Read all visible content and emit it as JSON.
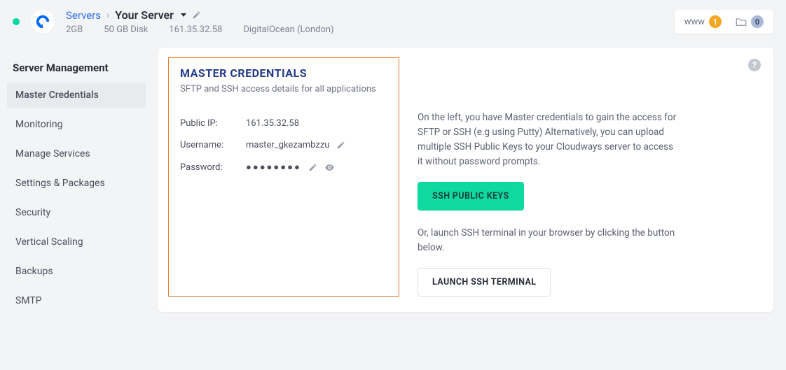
{
  "header": {
    "breadcrumb_root": "Servers",
    "breadcrumb_current": "Your Server",
    "specs": {
      "ram": "2GB",
      "disk": "50 GB Disk",
      "ip": "161.35.32.58",
      "provider_region": "DigitalOcean (London)"
    },
    "right": {
      "www_label": "www",
      "www_count": "1",
      "projects_count": "0"
    }
  },
  "sidebar": {
    "title": "Server Management",
    "items": [
      "Master Credentials",
      "Monitoring",
      "Manage Services",
      "Settings & Packages",
      "Security",
      "Vertical Scaling",
      "Backups",
      "SMTP"
    ]
  },
  "credentials": {
    "title": "MASTER CREDENTIALS",
    "subtitle": "SFTP and SSH access details for all applications",
    "rows": {
      "public_ip_label": "Public IP:",
      "public_ip_value": "161.35.32.58",
      "username_label": "Username:",
      "username_value": "master_gkezambzzu",
      "password_label": "Password:",
      "password_masked": "●●●●●●●●"
    }
  },
  "right_panel": {
    "info": "On the left, you have Master credentials to gain the access for SFTP or SSH (e.g using Putty) Alternatively, you can upload multiple SSH Public Keys to your Cloudways server to access it without password prompts.",
    "ssh_keys_button": "SSH PUBLIC KEYS",
    "or_text": "Or, launch SSH terminal in your browser by clicking the button below.",
    "launch_button": "LAUNCH SSH TERMINAL"
  }
}
